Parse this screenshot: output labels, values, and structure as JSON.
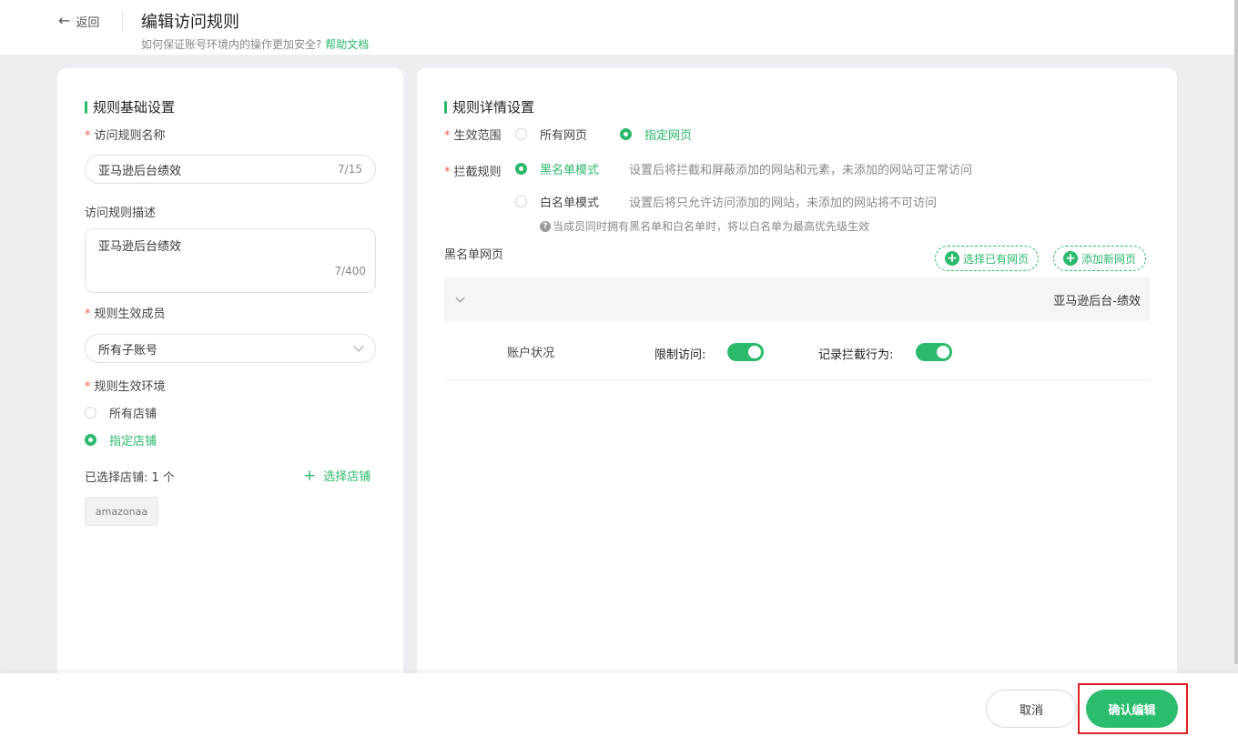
{
  "header": {
    "back_label": "返回",
    "title": "编辑访问规则",
    "subtitle_text": "如何保证账号环境内的操作更加安全?",
    "help_link": "帮助文档"
  },
  "left": {
    "section_title": "规则基础设置",
    "name_label": "访问规则名称",
    "name_value": "亚马逊后台绩效",
    "name_count": "7/15",
    "desc_label": "访问规则描述",
    "desc_value": "亚马逊后台绩效",
    "desc_count": "7/400",
    "members_label": "规则生效成员",
    "members_value": "所有子账号",
    "env_label": "规则生效环境",
    "env_options": [
      "所有店铺",
      "指定店铺"
    ],
    "env_selected": "指定店铺",
    "selected_shops_label": "已选择店铺: 1 个",
    "select_shop_link": "选择店铺",
    "shop_chips": [
      "amazonaa"
    ]
  },
  "right": {
    "section_title": "规则详情设置",
    "scope_label": "生效范围",
    "scope_options": [
      "所有网页",
      "指定网页"
    ],
    "scope_selected": "指定网页",
    "block_label": "拦截规则",
    "blacklist_label": "黑名单模式",
    "blacklist_desc": "设置后将拦截和屏蔽添加的网站和元素，未添加的网站可正常访问",
    "whitelist_label": "白名单模式",
    "whitelist_desc": "设置后将只允许访问添加的网站，未添加的网站将不可访问",
    "block_selected": "黑名单模式",
    "hint": "当成员同时拥有黑名单和白名单时，将以白名单为最高优先级生效",
    "list_title": "黑名单网页",
    "btn_select_existing": "选择已有网页",
    "btn_add_new": "添加新网页",
    "entry_title": "亚马逊后台-绩效",
    "entry_name": "账户状况",
    "restrict_label": "限制访问:",
    "restrict_on": true,
    "record_label": "记录拦截行为:",
    "record_on": true
  },
  "footer": {
    "cancel_label": "取消",
    "confirm_label": "确认编辑"
  },
  "colors": {
    "accent": "#2bb96b",
    "required": "#f25a4a",
    "highlight": "#e02020"
  }
}
